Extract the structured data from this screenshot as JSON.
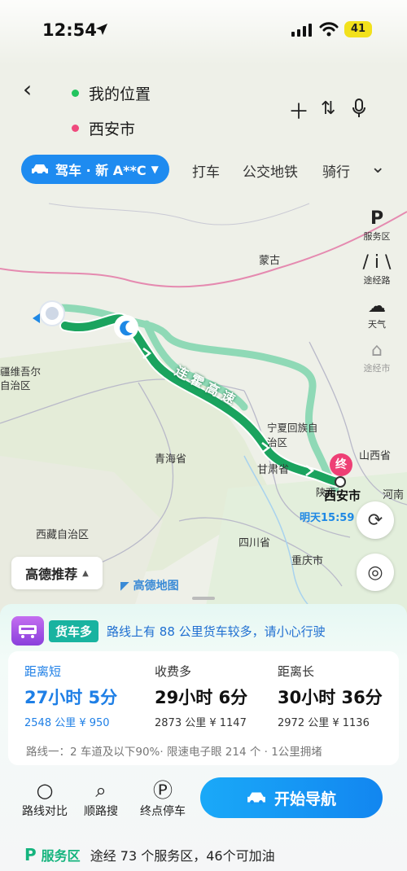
{
  "status": {
    "time": "12:54",
    "battery": "41"
  },
  "route": {
    "start": "我的位置",
    "end": "西安市",
    "start_color": "#22c45e",
    "end_color": "#ef4a7d"
  },
  "modes": {
    "selected": "驾车 · 新 A**C",
    "tabs": [
      "打车",
      "公交地铁",
      "骑行"
    ]
  },
  "map": {
    "labels": {
      "inner_mongolia": "蒙古",
      "xinjiang": "疆维吾尔\n自治区",
      "qinghai": "青海省",
      "ningxia": "宁夏回族自\n治区",
      "gansu": "甘肃省",
      "shanxi": "山西省",
      "shaanxi": "陕西",
      "henan": "河南",
      "tibet": "西藏自治区",
      "sichuan": "四川省",
      "chongqing": "重庆市",
      "highway": "连 霍 高 速"
    },
    "destination_city": "西安市",
    "destination_marker": "终",
    "eta": "明天15:59",
    "recommend": "高德推荐",
    "brand": "高德地图",
    "route_color": "#1aa35e",
    "alt_route_color": "#8fd9b6"
  },
  "tools": [
    {
      "icon": "parking-icon",
      "label": "服务区"
    },
    {
      "icon": "road-icon",
      "label": "途经路"
    },
    {
      "icon": "cloud-icon",
      "label": "天气"
    },
    {
      "icon": "city-icon",
      "label": "途经市"
    }
  ],
  "truck": {
    "tag": "货车多",
    "text": "路线上有 88 公里货车较多，请小心行驶"
  },
  "options": [
    {
      "tag": "距离短",
      "duration": "27小时 5分",
      "meta": "2548 公里  ¥ 950",
      "selected": true
    },
    {
      "tag": "收费多",
      "duration": "29小时 6分",
      "meta": "2873 公里  ¥ 1147",
      "selected": false
    },
    {
      "tag": "距离长",
      "duration": "30小时 36分",
      "meta": "2972 公里  ¥ 1136",
      "selected": false
    }
  ],
  "route_desc": "路线一：2 车道及以下90%· 限速电子眼 214 个 · 1公里拥堵",
  "actions": {
    "compare": "路线对比",
    "search": "顺路搜",
    "parking": "终点停车",
    "start": "开始导航"
  },
  "service": {
    "icon": "P",
    "label": "服务区",
    "text": "途经 73 个服务区，46个可加油"
  }
}
